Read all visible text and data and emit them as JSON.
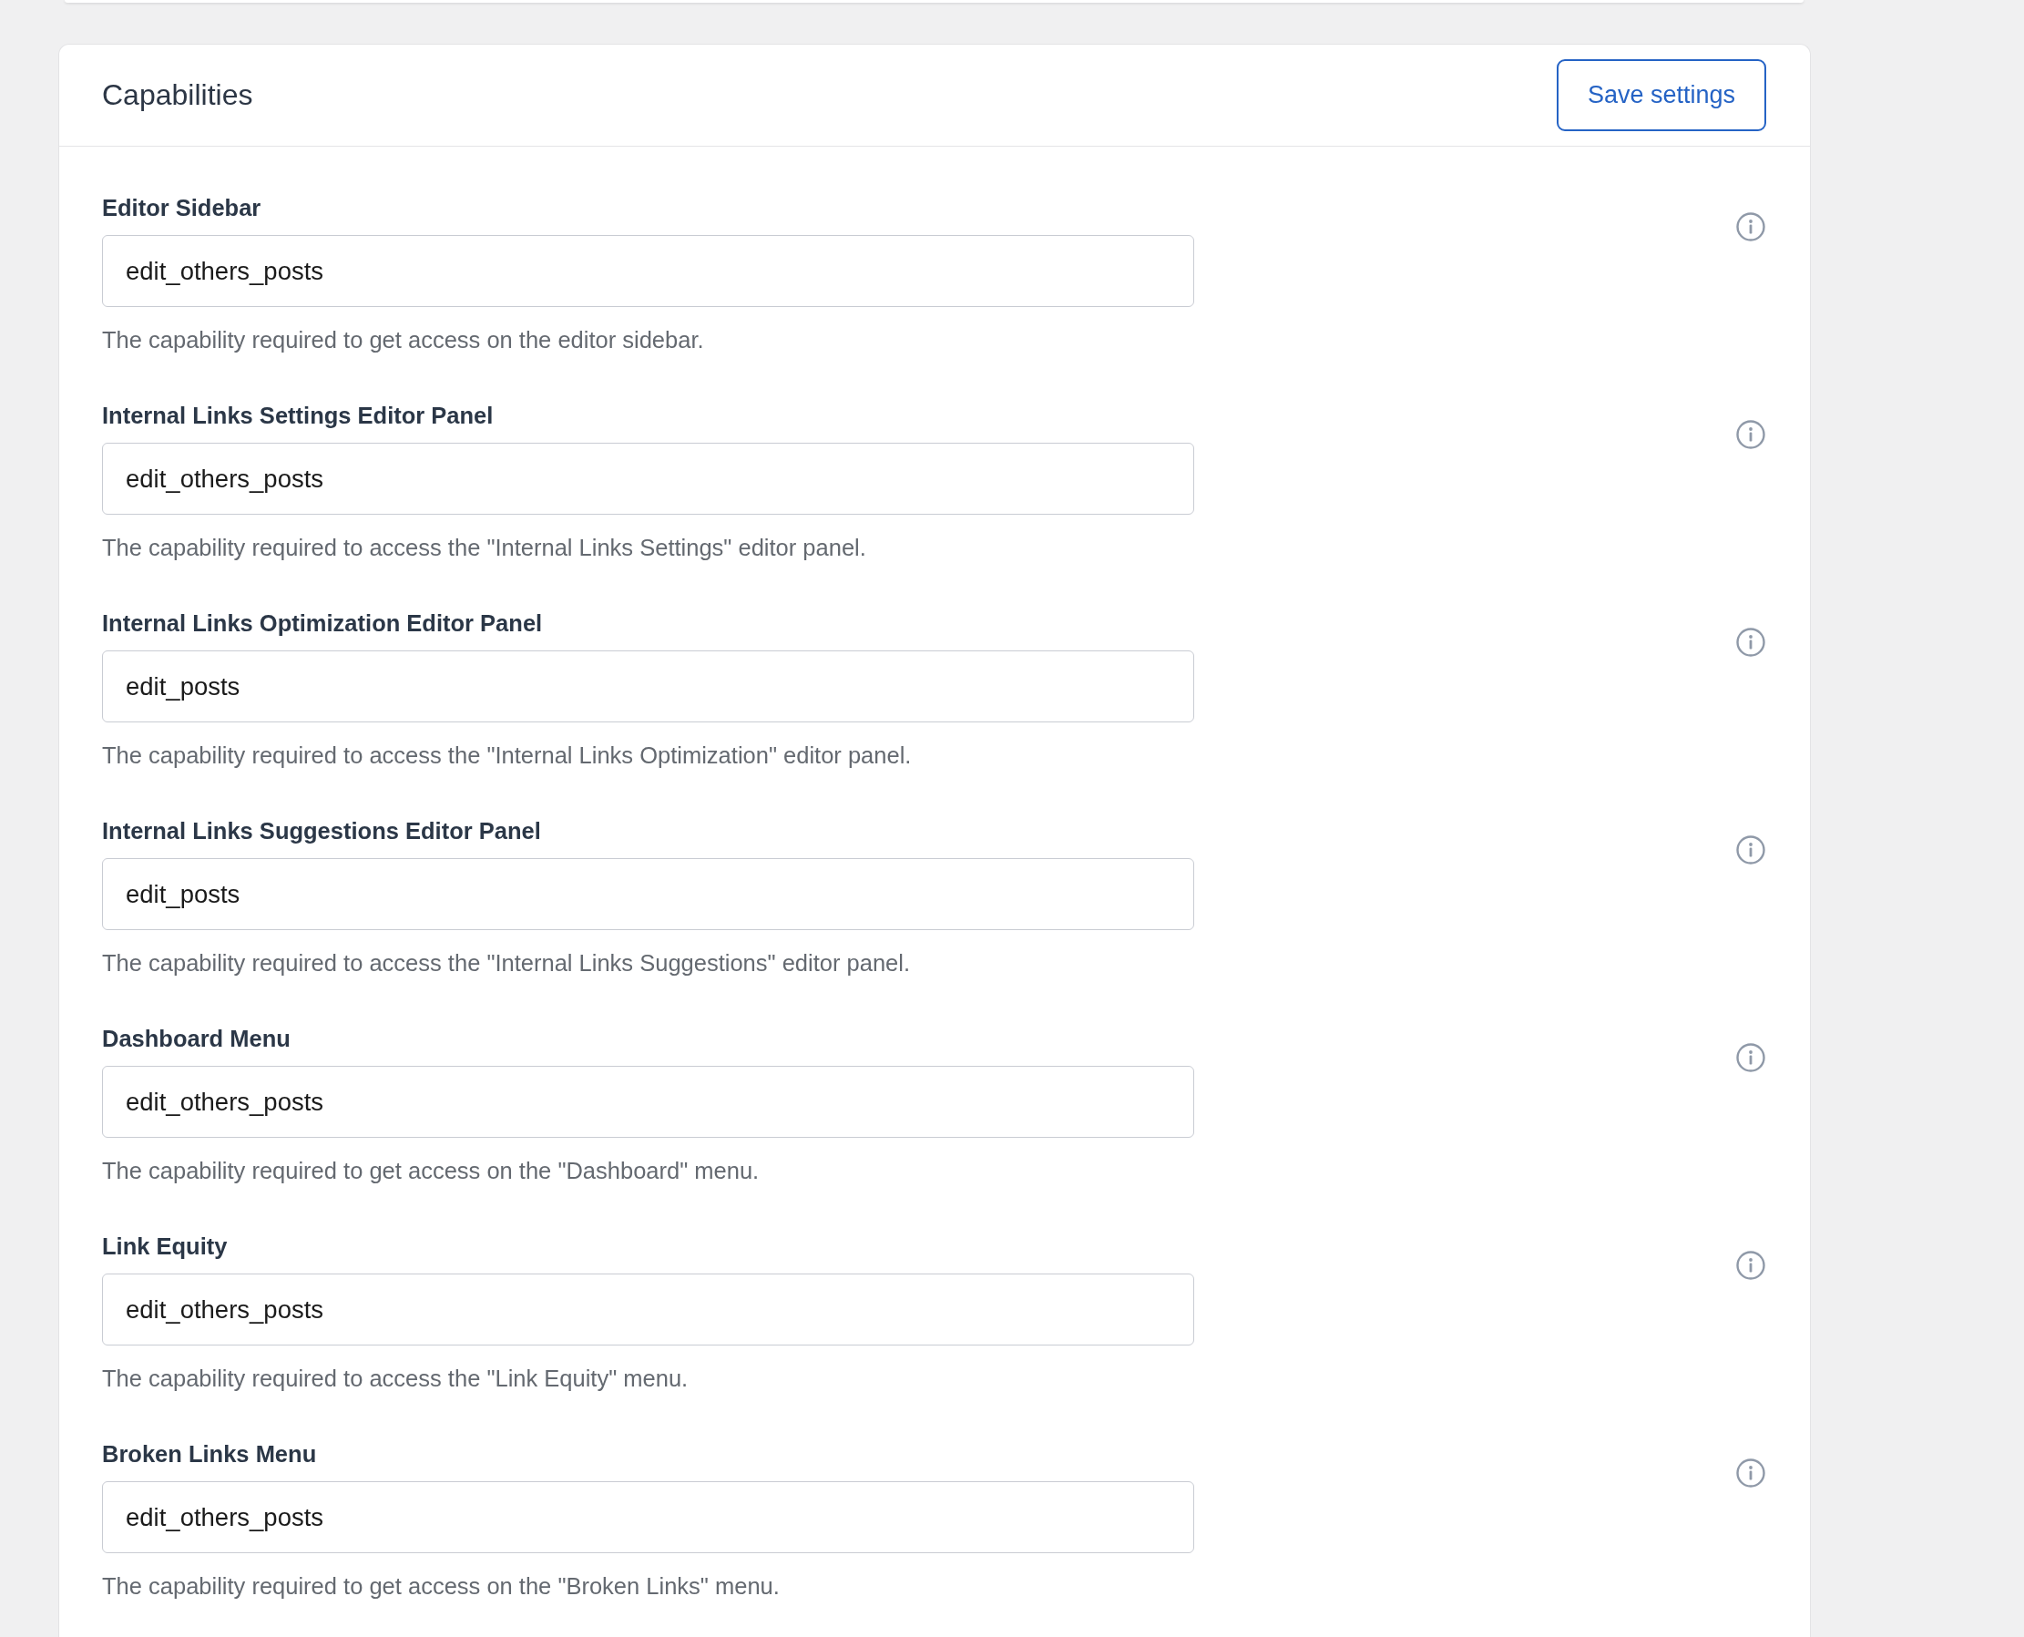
{
  "card": {
    "title": "Capabilities",
    "save_button": "Save settings"
  },
  "fields": [
    {
      "label": "Editor Sidebar",
      "value": "edit_others_posts",
      "description": "The capability required to get access on the editor sidebar."
    },
    {
      "label": "Internal Links Settings Editor Panel",
      "value": "edit_others_posts",
      "description": "The capability required to access the \"Internal Links Settings\" editor panel."
    },
    {
      "label": "Internal Links Optimization Editor Panel",
      "value": "edit_posts",
      "description": "The capability required to access the \"Internal Links Optimization\" editor panel."
    },
    {
      "label": "Internal Links Suggestions Editor Panel",
      "value": "edit_posts",
      "description": "The capability required to access the \"Internal Links Suggestions\" editor panel."
    },
    {
      "label": "Dashboard Menu",
      "value": "edit_others_posts",
      "description": "The capability required to get access on the \"Dashboard\" menu."
    },
    {
      "label": "Link Equity",
      "value": "edit_others_posts",
      "description": "The capability required to access the \"Link Equity\" menu."
    },
    {
      "label": "Broken Links Menu",
      "value": "edit_others_posts",
      "description": "The capability required to get access on the \"Broken Links\" menu."
    }
  ]
}
